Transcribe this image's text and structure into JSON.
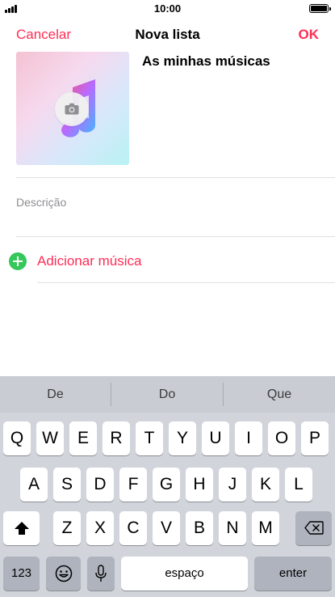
{
  "status": {
    "time": "10:00"
  },
  "nav": {
    "cancel": "Cancelar",
    "title": "Nova lista",
    "ok": "OK"
  },
  "playlist": {
    "title": "As minhas músicas",
    "description_placeholder": "Descrição"
  },
  "add_music": {
    "label": "Adicionar música"
  },
  "colors": {
    "accent": "#ff2d55",
    "add_green": "#34c759"
  },
  "keyboard": {
    "predictions": [
      "De",
      "Do",
      "Que"
    ],
    "row1": [
      "Q",
      "W",
      "E",
      "R",
      "T",
      "Y",
      "U",
      "I",
      "O",
      "P"
    ],
    "row2": [
      "A",
      "S",
      "D",
      "F",
      "G",
      "H",
      "J",
      "K",
      "L"
    ],
    "row3": [
      "Z",
      "X",
      "C",
      "V",
      "B",
      "N",
      "M"
    ],
    "numbers": "123",
    "space": "espaço",
    "enter": "enter"
  }
}
